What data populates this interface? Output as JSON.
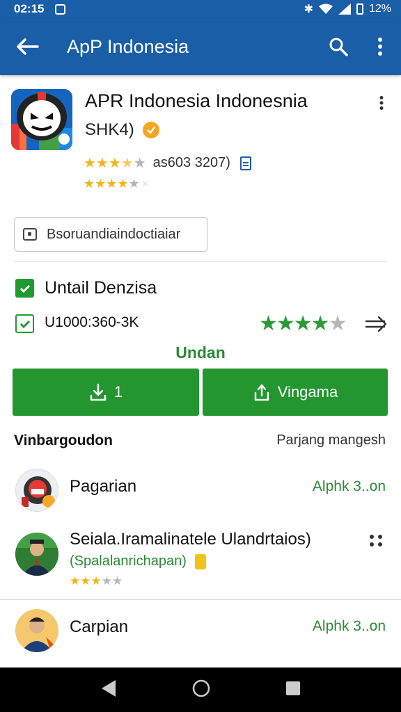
{
  "status_bar": {
    "time": "02:15",
    "battery": "12%"
  },
  "app_bar": {
    "title": "ApP Indonesia"
  },
  "app": {
    "name": "APR Indonesia Indonesnia",
    "developer": "SHK4)",
    "rating_primary": 3.5,
    "rating_secondary": 4.0,
    "rating_text": "as603 3207)",
    "tag": "Bsoruandiaindoctiaiar"
  },
  "details": {
    "item1": "Untail Denzisa",
    "item2": "U1000:360-3K",
    "item2_rating": 4.0
  },
  "install": {
    "label": "Undan",
    "left_button": "1",
    "right_button": "Vingama"
  },
  "section": {
    "title": "Vinbargoudon",
    "link": "Parjang mangesh"
  },
  "list": [
    {
      "title": "Pagarian",
      "right": "Alphk 3..on"
    },
    {
      "title": "Seiala.Iramalinatele Ulandrtaios)",
      "subtitle": "(Spalalanrichapan)",
      "rating": 3.0
    },
    {
      "title": "Carpian",
      "right": "Alphk 3..on"
    }
  ],
  "colors": {
    "primary": "#1a5ea8",
    "accent_green": "#23962f",
    "star_gold": "#f2b418"
  }
}
